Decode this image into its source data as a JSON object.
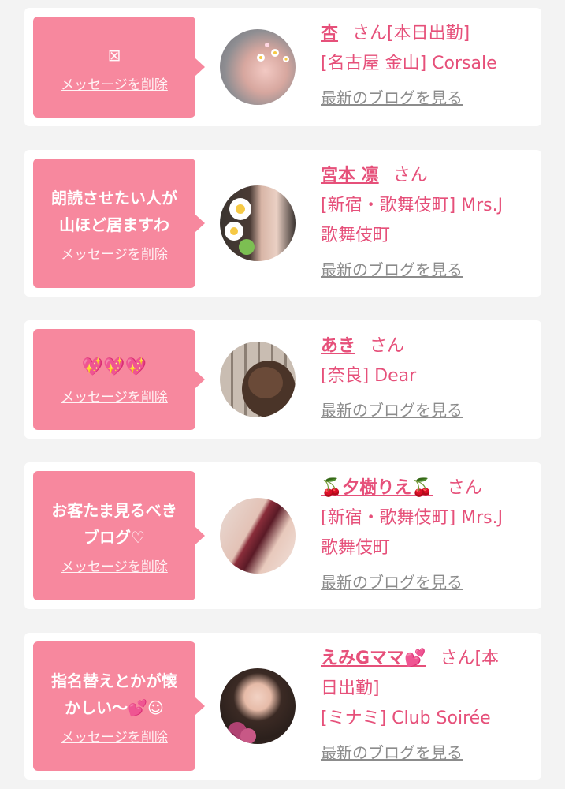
{
  "delete_label": "メッセージを削除",
  "blog_label": "最新のブログを見る",
  "cards": [
    {
      "message": "⊠",
      "name": "杏",
      "honorific": "さん[本日出勤]",
      "shop": "[名古屋 金山] Corsale"
    },
    {
      "message": "朗読させたい人が\n山ほど居ますわ",
      "name": "宮本 凛",
      "honorific": "さん",
      "shop": "[新宿・歌舞伎町] Mrs.J\n歌舞伎町"
    },
    {
      "message": "💖💖💖",
      "name": "あき",
      "honorific": "さん",
      "shop": "[奈良] Dear"
    },
    {
      "message": "お客たま見るべき\nブログ♡",
      "name": "🍒夕樹りえ🍒",
      "honorific": "さん",
      "shop": "[新宿・歌舞伎町] Mrs.J\n歌舞伎町"
    },
    {
      "message": "指名替えとかが懐\nかしい〜💕☺",
      "name": "えみGママ💕",
      "honorific": "さん[本\n日出勤]",
      "shop": "[ミナミ] Club Soirée"
    }
  ],
  "colors": {
    "bubble": "#f7889e",
    "accent": "#e6507a",
    "link_gray": "#8c8c8c",
    "background": "#f3f3f3"
  }
}
